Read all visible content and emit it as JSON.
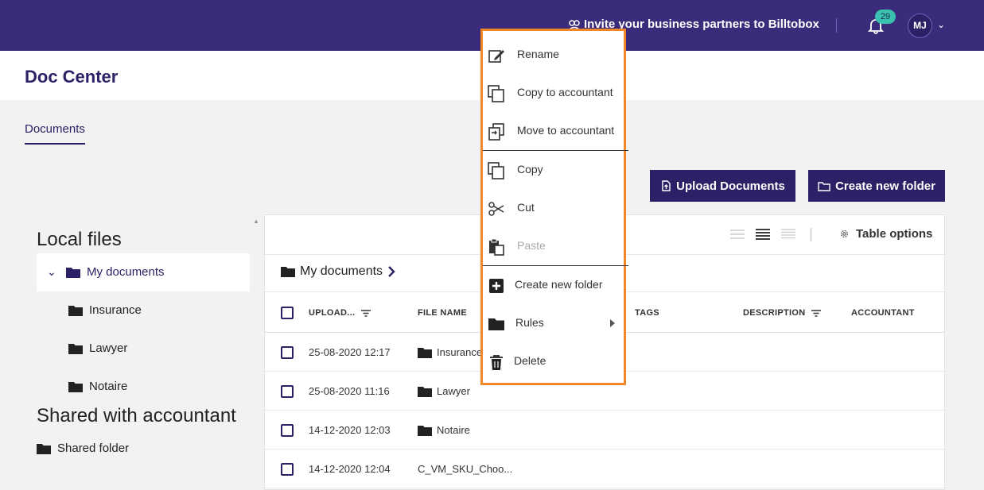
{
  "header": {
    "invite_text": "Invite your business partners to Billtobox",
    "notification_count": "29",
    "user_initials": "MJ"
  },
  "page": {
    "title": "Doc Center",
    "tab": "Documents"
  },
  "actions": {
    "upload": "Upload Documents",
    "create_folder": "Create new folder"
  },
  "sidebar": {
    "local_heading": "Local files",
    "items": [
      "My documents",
      "Insurance",
      "Lawyer",
      "Notaire"
    ],
    "shared_heading": "Shared with accountant",
    "shared_items": [
      "Shared folder"
    ]
  },
  "toolbar": {
    "table_options": "Table options"
  },
  "breadcrumb": {
    "current": "My documents"
  },
  "table": {
    "columns": [
      "UPLOAD...",
      "FILE NAME",
      "TAGS",
      "DESCRIPTION",
      "ACCOUNTANT"
    ],
    "rows": [
      {
        "uploaded": "25-08-2020 12:17",
        "name": "Insurance"
      },
      {
        "uploaded": "25-08-2020 11:16",
        "name": "Lawyer"
      },
      {
        "uploaded": "14-12-2020 12:03",
        "name": "Notaire"
      },
      {
        "uploaded": "14-12-2020 12:04",
        "name": "C_VM_SKU_Choo..."
      }
    ]
  },
  "context_menu": {
    "items": [
      {
        "label": "Rename",
        "icon": "rename-icon"
      },
      {
        "label": "Copy to accountant",
        "icon": "copy-icon"
      },
      {
        "label": "Move to accountant",
        "icon": "move-icon"
      },
      {
        "label": "Copy",
        "icon": "copy-icon"
      },
      {
        "label": "Cut",
        "icon": "scissors-icon"
      },
      {
        "label": "Paste",
        "icon": "paste-icon",
        "disabled": true
      },
      {
        "label": "Create new folder",
        "icon": "plus-icon"
      },
      {
        "label": "Rules",
        "icon": "folder-icon"
      },
      {
        "label": "Delete",
        "icon": "trash-icon"
      }
    ]
  },
  "colors": {
    "brand": "#3a2c7a",
    "accent_button": "#2c2166",
    "badge": "#39c2b0",
    "menu_border": "#f0882a"
  }
}
